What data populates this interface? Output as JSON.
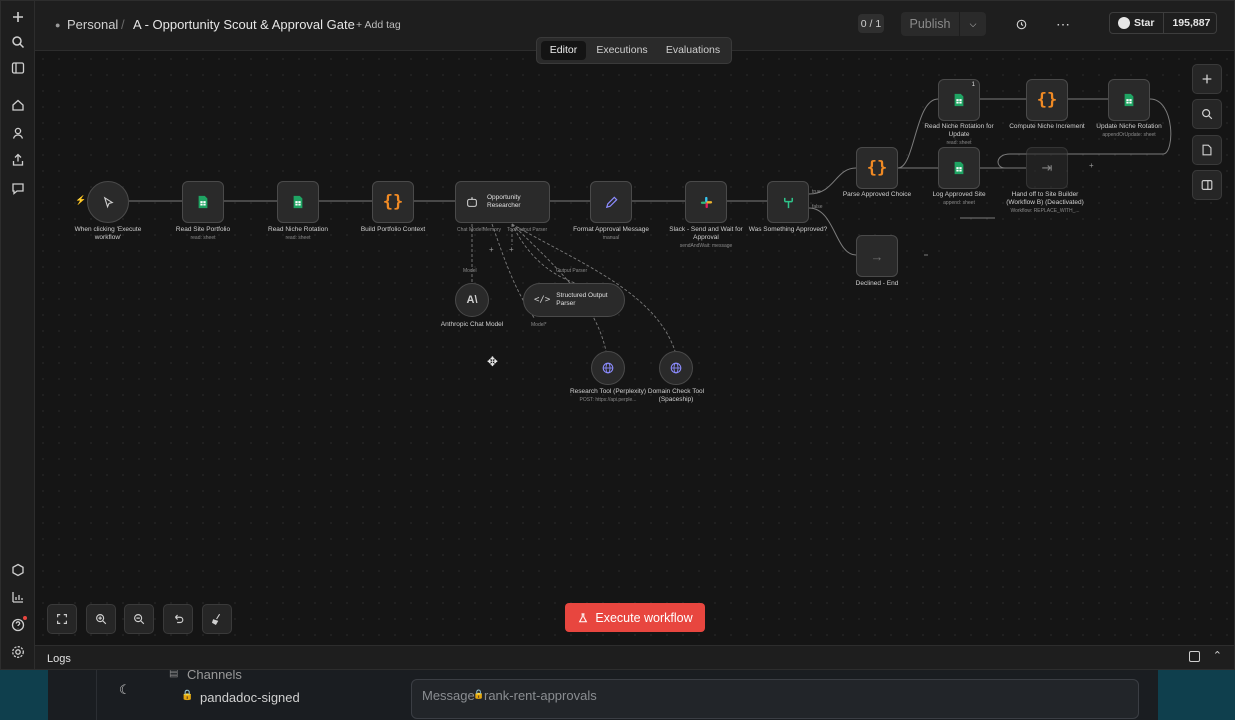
{
  "header": {
    "project": "Personal",
    "separator": "/",
    "workflow_title": "A - Opportunity Scout & Approval Gate",
    "add_tag": "+ Add tag",
    "counter": "0 / 1",
    "publish": "Publish",
    "star": "Star",
    "star_count": "195,887"
  },
  "tabs": [
    {
      "label": "Editor",
      "active": true
    },
    {
      "label": "Executions",
      "active": false
    },
    {
      "label": "Evaluations",
      "active": false
    }
  ],
  "nodes": {
    "trigger": {
      "label": "When clicking 'Execute workflow'"
    },
    "read_site_portfolio": {
      "label": "Read Site Portfolio",
      "sub": "read: sheet"
    },
    "read_niche_rotation": {
      "label": "Read Niche Rotation",
      "sub": "read: sheet"
    },
    "build_portfolio_context": {
      "label": "Build Portfolio Context"
    },
    "opportunity_researcher": {
      "label": "Opportunity Researcher"
    },
    "format_approval": {
      "label": "Format Approval Message",
      "sub": "manual"
    },
    "slack_send": {
      "label": "Slack - Send and Wait for Approval",
      "sub": "sendAndWait: message"
    },
    "was_approved": {
      "label": "Was Something Approved?"
    },
    "parse_choice": {
      "label": "Parse Approved Choice"
    },
    "declined": {
      "label": "Declined - End"
    },
    "read_niche_update": {
      "label": "Read Niche Rotation for Update",
      "sub": "read: sheet",
      "badge": "1"
    },
    "compute_increment": {
      "label": "Compute Niche Increment"
    },
    "update_rotation": {
      "label": "Update Niche Rotation",
      "sub": "appendOrUpdate: sheet"
    },
    "log_site": {
      "label": "Log Approved Site",
      "sub": "append: sheet"
    },
    "handoff": {
      "label": "Hand off to Site Builder (Workflow B) (Deactivated)",
      "sub": "Workflow: REPLACE_WITH_..."
    },
    "anthropic": {
      "label": "Anthropic Chat Model"
    },
    "output_parser": {
      "label": "Structured Output Parser"
    },
    "research_tool": {
      "label": "Research Tool (Perplexity)",
      "sub": "POST: https://api.perple..."
    },
    "domain_tool": {
      "label": "Domain Check Tool (Spaceship)"
    }
  },
  "connectors": {
    "chat_memory": "Chat Model*",
    "memory": "Memory",
    "tool": "Tool",
    "output_parser": "Output Parser",
    "model": "Model",
    "output_parser_2": "Output Parser",
    "model_2": "Model*",
    "true": "true",
    "false": "false"
  },
  "execute_button": "Execute workflow",
  "logs": "Logs",
  "slack": {
    "section": "Channels",
    "channel": "pandadoc-signed",
    "message_placeholder": "Message",
    "message_channel": "rank-rent-approvals"
  },
  "colors": {
    "accent": "#e8463f",
    "sheets_green": "#1fa463",
    "code_orange": "#f08a24"
  }
}
